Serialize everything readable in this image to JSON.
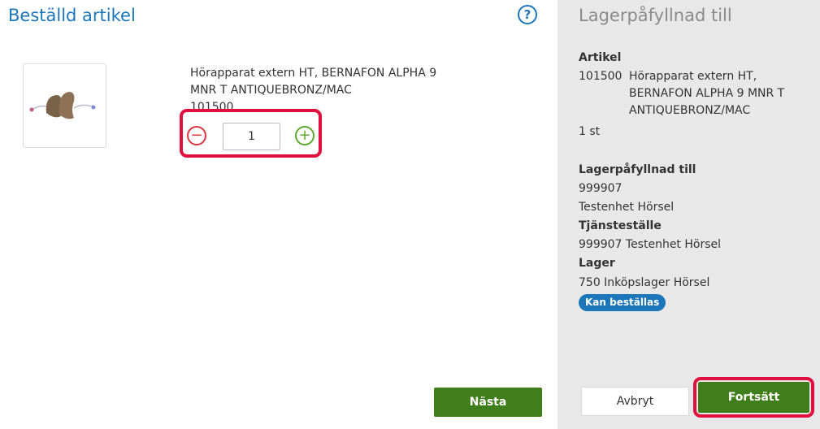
{
  "order": {
    "title": "Beställd artikel",
    "help_icon_glyph": "?",
    "product_image": "hearing-aid-icon",
    "item_name": "Hörapparat extern HT, BERNAFON ALPHA 9 MNR T ANTIQUEBRONZ/MAC",
    "item_number": "101500",
    "quantity": "1",
    "minus_glyph": "−",
    "plus_glyph": "+",
    "next_label": "Nästa"
  },
  "summary": {
    "title": "Lagerpåfyllnad till",
    "article_heading": "Artikel",
    "article_number": "101500",
    "article_desc": "Hörapparat extern HT, BERNAFON ALPHA 9 MNR T ANTIQUEBRONZ/MAC",
    "article_qty": "1 st",
    "restock_heading": "Lagerpåfyllnad till",
    "restock_id": "999907",
    "restock_name": "Testenhet Hörsel",
    "service_heading": "Tjänsteställe",
    "service_value": "999907 Testenhet Hörsel",
    "stock_heading": "Lager",
    "stock_value": "750 Inköpslager Hörsel",
    "status_badge": "Kan beställas",
    "cancel_label": "Avbryt",
    "continue_label": "Fortsätt"
  },
  "colors": {
    "accent_blue": "#1b77b9",
    "button_green": "#3f7e1a",
    "highlight_red": "#e0103e",
    "panel_gray": "#e8e8e8"
  }
}
